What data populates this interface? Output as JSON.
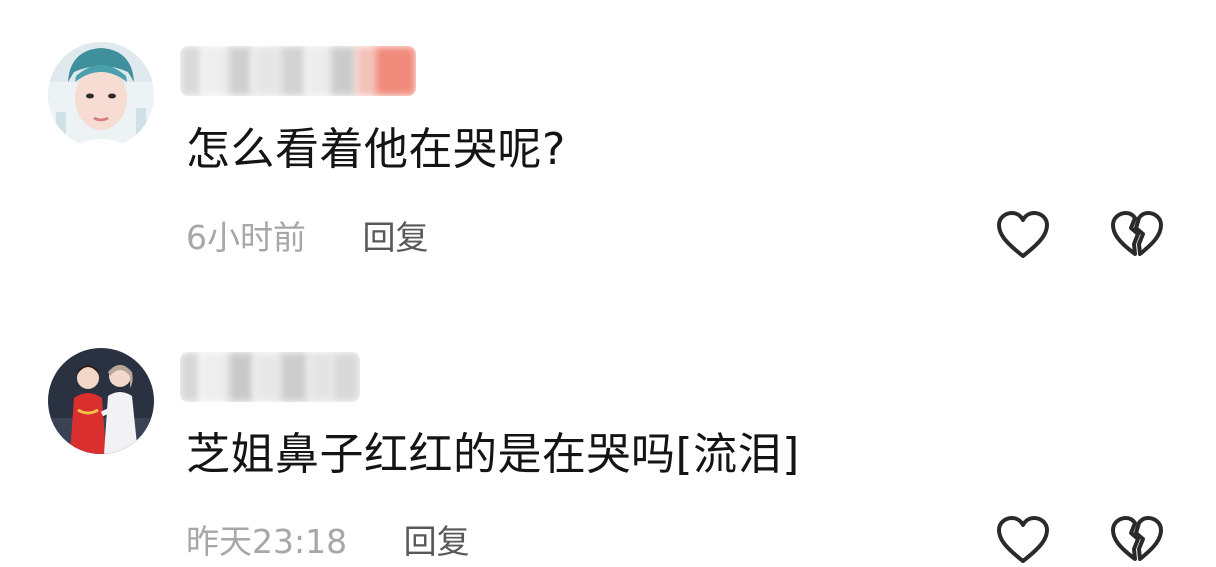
{
  "comments": [
    {
      "text": "怎么看着他在哭呢?",
      "time": "6小时前",
      "reply_label": "回复",
      "avatar_icon": "user-avatar-portrait",
      "like_icon": "heart-outline-icon",
      "dislike_icon": "broken-heart-icon"
    },
    {
      "text": "芝姐鼻子红红的是在哭吗[流泪]",
      "time": "昨天23:18",
      "reply_label": "回复",
      "avatar_icon": "user-avatar-two-women",
      "like_icon": "heart-outline-icon",
      "dislike_icon": "broken-heart-icon"
    }
  ],
  "colors": {
    "text": "#141414",
    "meta": "#a7a7a7",
    "reply": "#585858",
    "icon_stroke": "#2a2a2a",
    "blur_accent": "#f08a7a"
  }
}
